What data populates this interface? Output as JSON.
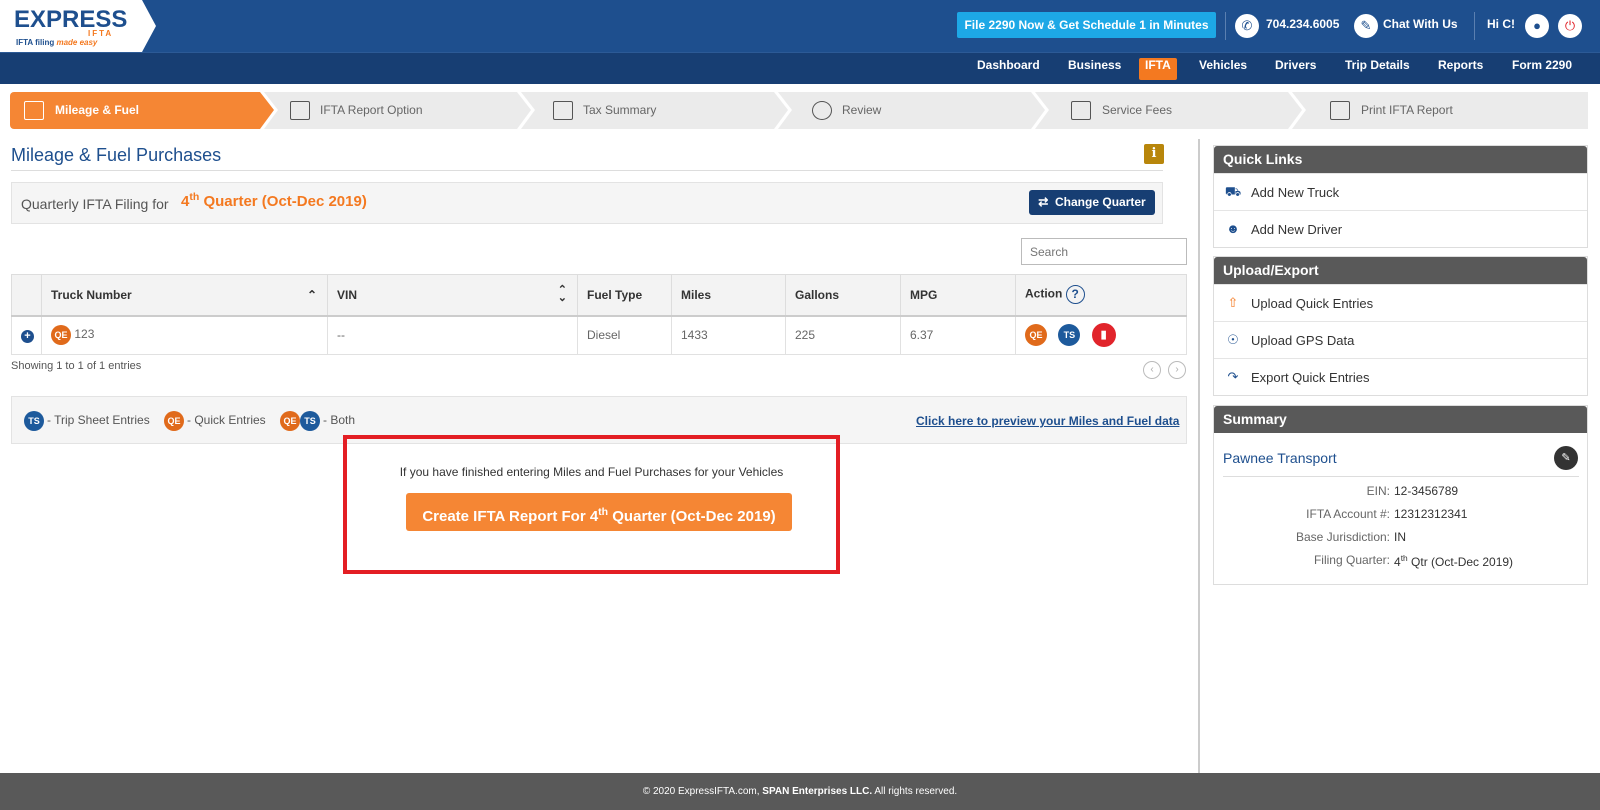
{
  "header": {
    "logo_text": "EXPRESS",
    "logo_sub": "IFTA",
    "logo_tagline": "IFTA filing",
    "logo_tagline_2": "made easy",
    "promo_label": "File 2290 Now & Get Schedule 1 in Minutes",
    "phone": "704.234.6005",
    "chat_label": "Chat With Us",
    "greeting": "Hi C!"
  },
  "nav": {
    "items": [
      "Dashboard",
      "Business",
      "IFTA",
      "Vehicles",
      "Drivers",
      "Trip Details",
      "Reports",
      "Form 2290"
    ],
    "active": "IFTA"
  },
  "steps": [
    {
      "label": "Mileage & Fuel",
      "icon": "fuel-pump-icon",
      "active": true
    },
    {
      "label": "IFTA Report Option",
      "icon": "report-chart-icon",
      "active": false
    },
    {
      "label": "Tax Summary",
      "icon": "calculator-icon",
      "active": false
    },
    {
      "label": "Review",
      "icon": "review-icon",
      "active": false
    },
    {
      "label": "Service Fees",
      "icon": "cash-register-icon",
      "active": false
    },
    {
      "label": "Print IFTA Report",
      "icon": "printer-icon",
      "active": false
    }
  ],
  "main": {
    "title": "Mileage & Fuel Purchases",
    "quarter_label": "Quarterly IFTA Filing for",
    "quarter_num": "4",
    "quarter_sup": "th",
    "quarter_rest": "Quarter (Oct-Dec 2019)",
    "change_quarter_label": "Change Quarter",
    "search_placeholder": "Search"
  },
  "table": {
    "columns": [
      "Truck Number",
      "VIN",
      "Fuel Type",
      "Miles",
      "Gallons",
      "MPG",
      "Action"
    ],
    "rows": [
      {
        "truck": "123",
        "vin": "--",
        "fuel": "Diesel",
        "miles": "1433",
        "gallons": "225",
        "mpg": "6.37"
      }
    ],
    "showing": "Showing 1 to 1 of 1 entries"
  },
  "legend": {
    "ts_text": "- Trip Sheet Entries",
    "qe_text": "- Quick Entries",
    "both_text": "- Both",
    "qe_badge": "QE",
    "ts_badge": "TS",
    "preview_link": "Click here to preview your Miles and Fuel data"
  },
  "cta": {
    "hint": "If you have finished entering Miles and Fuel Purchases for your Vehicles",
    "button_pre": "Create IFTA Report For 4",
    "button_sup": "th",
    "button_post": "Quarter (Oct-Dec 2019)"
  },
  "quick_links": {
    "title": "Quick Links",
    "items": [
      "Add New Truck",
      "Add New Driver"
    ]
  },
  "upload_export": {
    "title": "Upload/Export",
    "items": [
      "Upload Quick Entries",
      "Upload GPS Data",
      "Export Quick Entries"
    ]
  },
  "summary": {
    "title": "Summary",
    "business_name": "Pawnee Transport",
    "ein_label": "EIN:",
    "ein": "12-3456789",
    "account_label": "IFTA Account #:",
    "account": "12312312341",
    "jurisdiction_label": "Base Jurisdiction:",
    "jurisdiction": "IN",
    "quarter_label": "Filing Quarter:",
    "quarter_num": "4",
    "quarter_sup": "th",
    "quarter_rest": "Qtr (Oct-Dec 2019)"
  },
  "footer": {
    "pre": "© 2020 ExpressIFTA.com,",
    "company": "SPAN Enterprises LLC.",
    "post": "All rights reserved."
  },
  "colors": {
    "brand_blue": "#1e4f8e",
    "accent_orange": "#f47920",
    "promo_cyan": "#1da8e6",
    "highlight_red": "#e31e24"
  }
}
